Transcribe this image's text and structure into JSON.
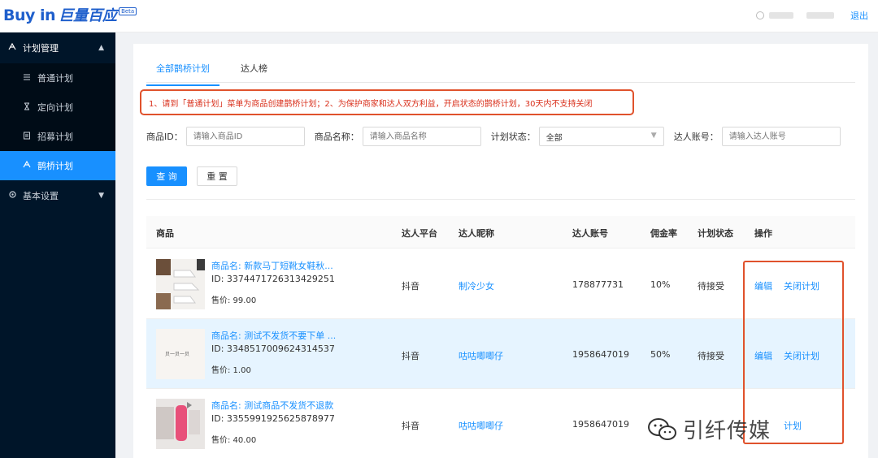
{
  "header": {
    "logo_en": "Buy in",
    "logo_cn": "巨量百应",
    "logo_badge": "Beta",
    "logout": "退出"
  },
  "sidebar": {
    "group1": {
      "label": "计划管理",
      "expanded": true
    },
    "items": [
      {
        "label": "普通计划",
        "icon": "list-icon"
      },
      {
        "label": "定向计划",
        "icon": "hourglass-icon"
      },
      {
        "label": "招募计划",
        "icon": "recruit-icon"
      },
      {
        "label": "鹊桥计划",
        "icon": "bridge-icon",
        "active": true
      }
    ],
    "group2": {
      "label": "基本设置",
      "expanded": false
    }
  },
  "tabs": [
    {
      "label": "全部鹊桥计划",
      "active": true
    },
    {
      "label": "达人榜",
      "active": false
    }
  ],
  "notice": "1、请到「普通计划」菜单为商品创建鹊桥计划；2、为保护商家和达人双方利益，开启状态的鹊桥计划，30天内不支持关闭",
  "filters": {
    "product_id": {
      "label": "商品ID：",
      "placeholder": "请输入商品ID"
    },
    "product_name": {
      "label": "商品名称：",
      "placeholder": "请输入商品名称"
    },
    "plan_status": {
      "label": "计划状态：",
      "value": "全部"
    },
    "talent_account": {
      "label": "达人账号：",
      "placeholder": "请输入达人账号"
    }
  },
  "buttons": {
    "query": "查 询",
    "reset": "重 置"
  },
  "table": {
    "headers": [
      "商品",
      "达人平台",
      "达人昵称",
      "达人账号",
      "佣金率",
      "计划状态",
      "操作"
    ],
    "rows": [
      {
        "name": "商品名: 新款马丁短靴女鞋秋...",
        "id": "ID: 3374471726313429251",
        "price": "售价:   99.00",
        "platform": "抖音",
        "nickname": "制冷少女",
        "account": "178877731",
        "commission": "10%",
        "status": "待接受",
        "action_edit": "编辑",
        "action_close": "关闭计划",
        "highlighted": false
      },
      {
        "name": "商品名: 测试不发货不要下单 ...",
        "id": "ID: 3348517009624314537",
        "price": "售价:   1.00",
        "thumb_text": "贝一贝一贝",
        "platform": "抖音",
        "nickname": "咕咕唧唧仔",
        "account": "1958647019",
        "commission": "50%",
        "status": "待接受",
        "action_edit": "编辑",
        "action_close": "关闭计划",
        "highlighted": true
      },
      {
        "name": "商品名: 测试商品不发货不退款",
        "id": "ID: 3355991925625878977",
        "price": "售价:   40.00",
        "platform": "抖音",
        "nickname": "咕咕唧唧仔",
        "account": "1958647019",
        "action_close": "计划",
        "highlighted": false
      }
    ]
  },
  "watermark": "引纤传媒",
  "colors": {
    "primary": "#1890ff",
    "sidebar_bg": "#001529",
    "notice_red": "#d9301c",
    "box_red": "#e0522c"
  }
}
